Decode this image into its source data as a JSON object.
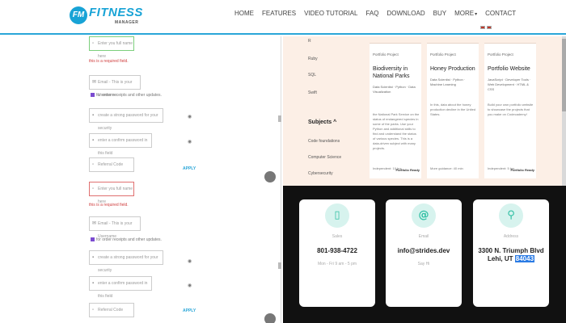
{
  "header": {
    "logo": {
      "mark": "FM",
      "name": "FITNESS",
      "tagline": "MANAGER"
    },
    "nav": [
      "HOME",
      "FEATURES",
      "VIDEO TUTORIAL",
      "FAQ",
      "DOWNLOAD",
      "BUY",
      "MORE",
      "CONTACT"
    ]
  },
  "form": {
    "name_placeholder": "Enter you full name here",
    "required_msg": "this is a required field.",
    "email_placeholder": "Email - This is your Username",
    "order_checkbox": "for order receipts and other updates.",
    "password_placeholder": "create a strong password for your security",
    "confirm_placeholder": "enter a confirm password in this field",
    "referral_placeholder": "Referral Code",
    "apply_label": "APPLY"
  },
  "resume": {
    "skills": [
      "R",
      "Ruby",
      "SQL",
      "Swift"
    ],
    "subjects_heading": "Subjects",
    "subjects": [
      "Code foundations",
      "Computer Science",
      "Cybersecurity"
    ],
    "cards": [
      {
        "tag": "Portfolio Project",
        "title": "Biodiversity in National Parks",
        "tech": "Data Scientist · Python · Data Visualization",
        "desc": "the National Park Service on the status of endangered species in some of the parks. Use your Python and additional skills to find and understand the status of various species. This is a data-driven subject with many projects.",
        "foot": "Independent: 10 hrs",
        "badge": "Portfolio Ready"
      },
      {
        "tag": "Portfolio Project",
        "title": "Honey Production",
        "tech": "Data Scientist · Python · Machine Learning",
        "desc": "In this, data about the honey production decline in the United States.",
        "foot": "More guidance: 40 min",
        "badge": ""
      },
      {
        "tag": "Portfolio Project",
        "title": "Portfolio Website",
        "tech": "JavaScript · Developer Tools · Web Development · HTML & CSS",
        "desc": "Build your own portfolio website to showcase the projects that you make on Codecademy!",
        "foot": "Independent: 5 hrs",
        "badge": "Portfolio Ready"
      }
    ]
  },
  "contact": {
    "cards": [
      {
        "icon": "phone-icon",
        "glyph": "▯",
        "label": "Sales",
        "value": "801-938-4722",
        "sub": "Mon - Fri 9 am - 5 pm"
      },
      {
        "icon": "at-icon",
        "glyph": "@",
        "label": "Email",
        "value": "info@strides.dev",
        "sub": "Say Hi"
      },
      {
        "icon": "map-pin-icon",
        "glyph": "⚲",
        "label": "Address",
        "value_line1": "3300 N. Triumph Blvd",
        "value_line2_pre": "Lehi, UT ",
        "value_line2_hl": "84043",
        "sub": ""
      }
    ]
  },
  "colors": {
    "accent": "#2aa6d8",
    "teal": "#2fbfa3",
    "error": "#d04040",
    "dark": "#111111",
    "peach": "#fcefe6"
  }
}
